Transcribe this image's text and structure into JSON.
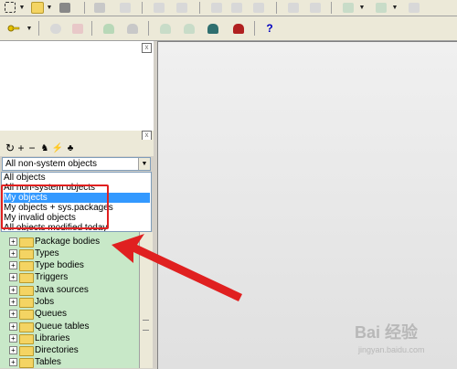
{
  "toolbar_main": {
    "icons": [
      "new-file-icon",
      "open-folder-icon",
      "save-icon",
      "print-icon",
      "disabled-icon",
      "undo-icon",
      "redo-icon",
      "cut-icon",
      "copy-icon",
      "paste-icon",
      "find-icon",
      "replace-icon",
      "window-icon",
      "window-list-icon"
    ]
  },
  "toolbar_second": {
    "icons": [
      "key-icon",
      "settings-icon",
      "brush-icon",
      "db-icon",
      "db2-icon",
      "db3-icon",
      "db4-icon",
      "db5-icon",
      "db6-icon",
      "help-icon"
    ],
    "help_label": "?"
  },
  "object_browser": {
    "selected_filter": "All non-system objects",
    "options": [
      {
        "label": "All objects",
        "selected": false
      },
      {
        "label": "All non-system objects",
        "selected": false
      },
      {
        "label": "My objects",
        "selected": true
      },
      {
        "label": "My objects + sys.packages",
        "selected": false
      },
      {
        "label": "My invalid objects",
        "selected": false
      },
      {
        "label": "All objects modified today",
        "selected": false
      }
    ],
    "tree_items": [
      "Package bodies",
      "Types",
      "Type bodies",
      "Triggers",
      "Java sources",
      "Jobs",
      "Queues",
      "Queue tables",
      "Libraries",
      "Directories",
      "Tables"
    ],
    "expander_glyph": "+"
  },
  "panel_close_glyph": "x",
  "watermark": {
    "line1": "Bai 经验",
    "line2": "jingyan.baidu.com"
  },
  "colors": {
    "highlight": "#3399ff",
    "annotation": "#e02020",
    "tree_bg": "#c8e8c8"
  }
}
